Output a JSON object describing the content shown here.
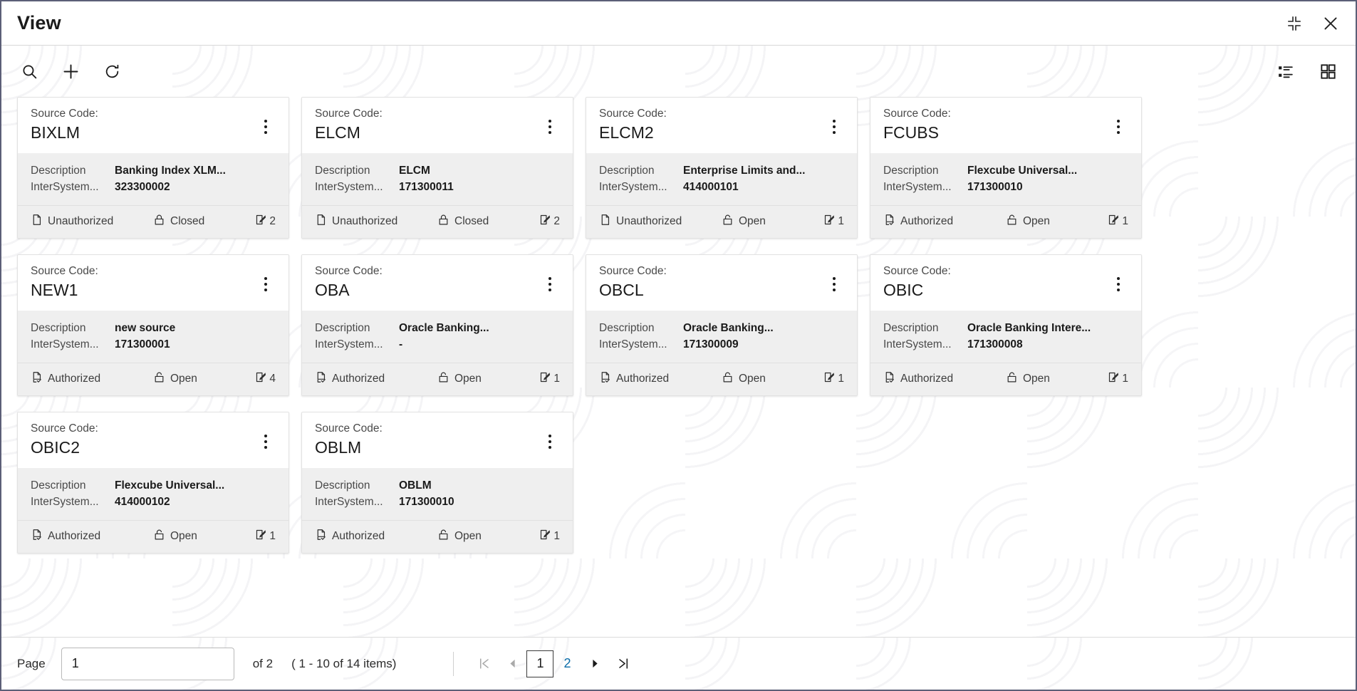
{
  "window": {
    "title": "View",
    "actions": [
      {
        "name": "collapse-icon",
        "label": "Collapse"
      },
      {
        "name": "close-icon",
        "label": "Close"
      }
    ]
  },
  "toolbar": {
    "left": [
      {
        "name": "search-icon",
        "label": "Search"
      },
      {
        "name": "add-icon",
        "label": "Add"
      },
      {
        "name": "refresh-icon",
        "label": "Refresh"
      }
    ],
    "right": [
      {
        "name": "list-view-icon",
        "label": "List View"
      },
      {
        "name": "grid-view-icon",
        "label": "Grid View"
      }
    ]
  },
  "card_fields": {
    "source_code_label": "Source Code:",
    "description_label": "Description",
    "intersystem_label": "InterSystem..."
  },
  "cards": [
    {
      "source_code": "BIXLM",
      "description": "Banking Index XLM...",
      "intersystem": "323300002",
      "auth_status": "Unauthorized",
      "auth_icon": "document-icon",
      "lock_status": "Closed",
      "lock_icon": "lock-closed-icon",
      "edit_count": "2"
    },
    {
      "source_code": "ELCM",
      "description": "ELCM",
      "intersystem": "171300011",
      "auth_status": "Unauthorized",
      "auth_icon": "document-icon",
      "lock_status": "Closed",
      "lock_icon": "lock-closed-icon",
      "edit_count": "2"
    },
    {
      "source_code": "ELCM2",
      "description": "Enterprise Limits and...",
      "intersystem": "414000101",
      "auth_status": "Unauthorized",
      "auth_icon": "document-icon",
      "lock_status": "Open",
      "lock_icon": "lock-open-icon",
      "edit_count": "1"
    },
    {
      "source_code": "FCUBS",
      "description": "Flexcube Universal...",
      "intersystem": "171300010",
      "auth_status": "Authorized",
      "auth_icon": "document-check-icon",
      "lock_status": "Open",
      "lock_icon": "lock-open-icon",
      "edit_count": "1"
    },
    {
      "source_code": "NEW1",
      "description": "new source",
      "intersystem": "171300001",
      "auth_status": "Authorized",
      "auth_icon": "document-check-icon",
      "lock_status": "Open",
      "lock_icon": "lock-open-icon",
      "edit_count": "4"
    },
    {
      "source_code": "OBA",
      "description": "Oracle Banking...",
      "intersystem": "-",
      "auth_status": "Authorized",
      "auth_icon": "document-check-icon",
      "lock_status": "Open",
      "lock_icon": "lock-open-icon",
      "edit_count": "1"
    },
    {
      "source_code": "OBCL",
      "description": "Oracle Banking...",
      "intersystem": "171300009",
      "auth_status": "Authorized",
      "auth_icon": "document-check-icon",
      "lock_status": "Open",
      "lock_icon": "lock-open-icon",
      "edit_count": "1"
    },
    {
      "source_code": "OBIC",
      "description": "Oracle Banking Intere...",
      "intersystem": "171300008",
      "auth_status": "Authorized",
      "auth_icon": "document-check-icon",
      "lock_status": "Open",
      "lock_icon": "lock-open-icon",
      "edit_count": "1"
    },
    {
      "source_code": "OBIC2",
      "description": "Flexcube Universal...",
      "intersystem": "414000102",
      "auth_status": "Authorized",
      "auth_icon": "document-check-icon",
      "lock_status": "Open",
      "lock_icon": "lock-open-icon",
      "edit_count": "1"
    },
    {
      "source_code": "OBLM",
      "description": "OBLM",
      "intersystem": "171300010",
      "auth_status": "Authorized",
      "auth_icon": "document-check-icon",
      "lock_status": "Open",
      "lock_icon": "lock-open-icon",
      "edit_count": "1"
    }
  ],
  "pagination": {
    "page_label": "Page",
    "page_value": "1",
    "of_text": "of 2",
    "items_text": "( 1 - 10 of 14 items)",
    "first_icon": "first-page-icon",
    "prev_icon": "prev-page-icon",
    "next_icon": "next-page-icon",
    "last_icon": "last-page-icon",
    "pages": [
      {
        "label": "1",
        "active": true
      },
      {
        "label": "2",
        "active": false
      }
    ]
  },
  "colors": {
    "window_border": "#5c5f77",
    "card_bg": "#f0f0f0",
    "card_head_bg": "#ffffff",
    "link_blue": "#0a6ca8",
    "text_primary": "#1a1a1a",
    "text_secondary": "#4a4a4a"
  }
}
